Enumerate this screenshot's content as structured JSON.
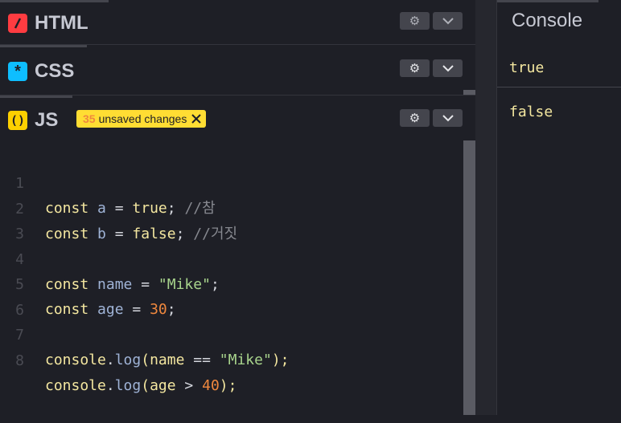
{
  "panels": {
    "html": {
      "label": "HTML",
      "icon": "slash-icon",
      "color": "#ff3c41"
    },
    "css": {
      "label": "CSS",
      "icon": "asterisk-icon",
      "color": "#0ebeff"
    },
    "js": {
      "label": "JS",
      "icon": "parens-icon",
      "color": "#fcd000"
    }
  },
  "unsaved": {
    "count": "35",
    "text": "unsaved changes"
  },
  "code": {
    "line_numbers": [
      "1",
      "2",
      "3",
      "4",
      "5",
      "6",
      "7",
      "8"
    ],
    "l1": {
      "kw": "const",
      "var": "a",
      "op": "=",
      "val": "true",
      "semi": ";",
      "cmt": "//참"
    },
    "l2": {
      "kw": "const",
      "var": "b",
      "op": "=",
      "val": "false",
      "semi": ";",
      "cmt": "//거짓"
    },
    "l4": {
      "kw": "const",
      "var": "name",
      "op": "=",
      "val": "\"Mike\"",
      "semi": ";"
    },
    "l5": {
      "kw": "const",
      "var": "age",
      "op": "=",
      "val": "30",
      "semi": ";"
    },
    "l7": {
      "obj": "console",
      "dot": ".",
      "fn": "log",
      "open": "(",
      "arg1": "name",
      "op": "==",
      "arg2": "\"Mike\"",
      "close": ");"
    },
    "l8": {
      "obj": "console",
      "dot": ".",
      "fn": "log",
      "open": "(",
      "arg1": "age",
      "op": ">",
      "arg2": "40",
      "close": ");"
    }
  },
  "console": {
    "title": "Console",
    "outputs": [
      "true",
      "false"
    ]
  }
}
